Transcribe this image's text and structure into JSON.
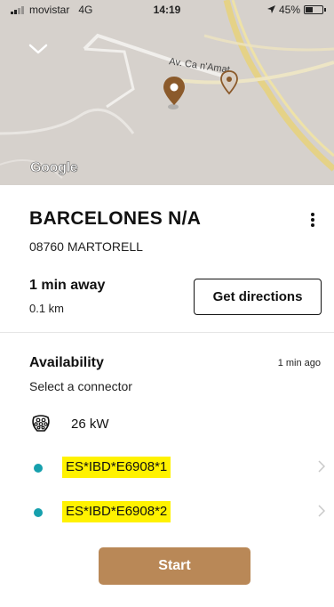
{
  "status_bar": {
    "carrier": "movistar",
    "network": "4G",
    "time": "14:19",
    "battery": "45%",
    "battery_level": 0.45
  },
  "map": {
    "road_label": "Av. Ca n'Amat",
    "attribution": "Google"
  },
  "station": {
    "name": "BARCELONES N/A",
    "address": "08760 MARTORELL",
    "time_away": "1 min away",
    "distance": "0.1 km",
    "directions_label": "Get directions"
  },
  "availability": {
    "title": "Availability",
    "updated": "1 min ago",
    "select_label": "Select a connector",
    "power": "26 kW",
    "connectors": [
      {
        "id": "ES*IBD*E6908*1"
      },
      {
        "id": "ES*IBD*E6908*2"
      }
    ]
  },
  "actions": {
    "start_label": "Start"
  },
  "colors": {
    "accent": "#b98857",
    "status_available": "#16a0ad",
    "highlight": "#fff200",
    "map_bg": "#d9d4cf"
  }
}
